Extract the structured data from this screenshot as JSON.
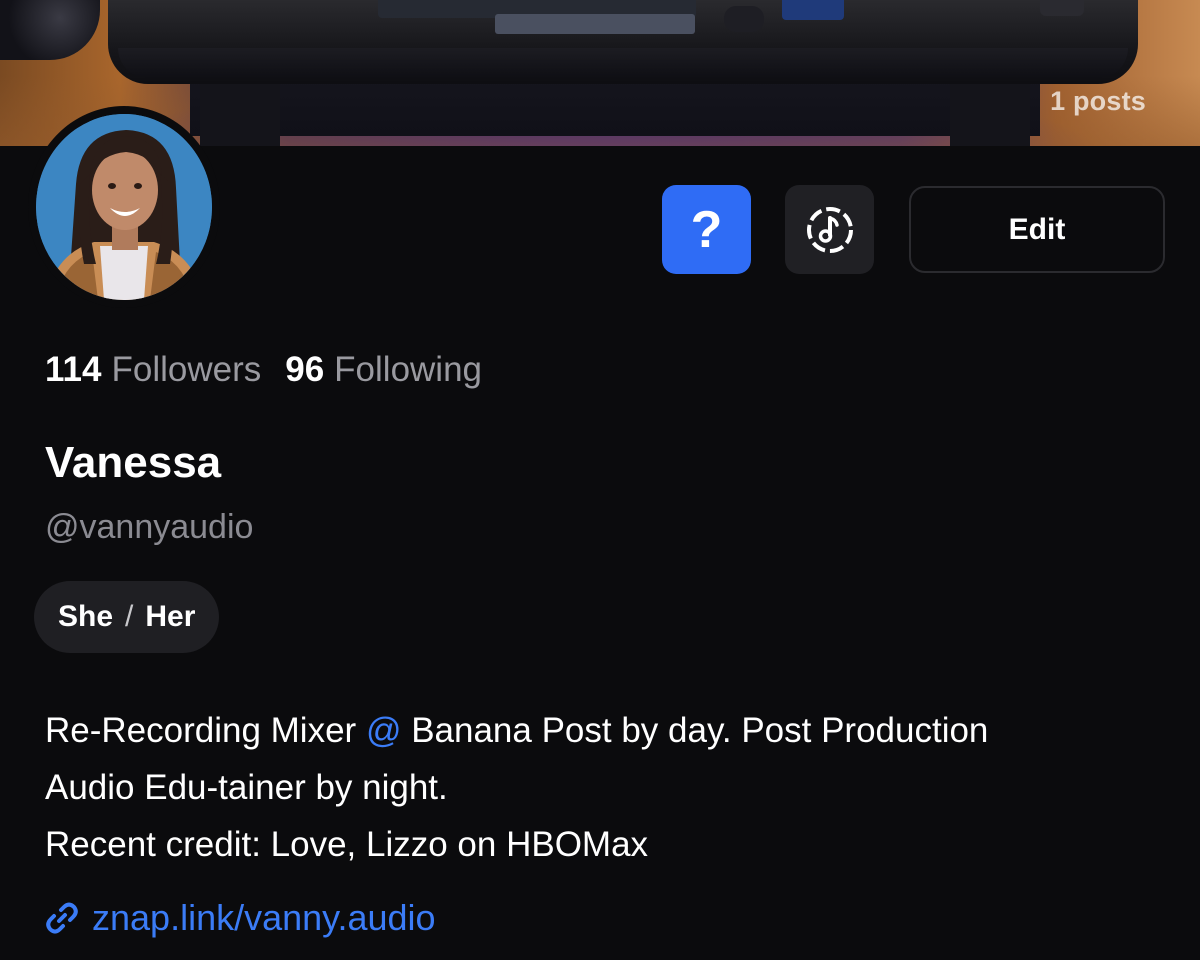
{
  "cover": {
    "posts_count": "1 posts"
  },
  "profile": {
    "name": "Vanessa",
    "handle": "@vannyaudio",
    "avatar": "profile-photo"
  },
  "actions": {
    "help_label": "?",
    "help_icon": "question-icon",
    "music_icon": "music-note-icon",
    "edit_label": "Edit"
  },
  "stats": {
    "followers_count": "114",
    "followers_label": "Followers",
    "following_count": "96",
    "following_label": "Following"
  },
  "pronouns": {
    "first": "She",
    "separator": "/",
    "second": "Her"
  },
  "bio": {
    "line1_before": "Re-Recording Mixer ",
    "line1_at": "@",
    "line1_after": " Banana Post by day. Post Production",
    "line2": "Audio Edu-tainer by night.",
    "line3": "Recent credit: Love, Lizzo on HBOMax"
  },
  "link": {
    "icon": "link-icon",
    "text": "znap.link/vanny.audio"
  },
  "colors": {
    "background": "#0b0b0d",
    "accent": "#2f6cf5",
    "link": "#3b7cf7",
    "muted": "#9a9aa0"
  }
}
